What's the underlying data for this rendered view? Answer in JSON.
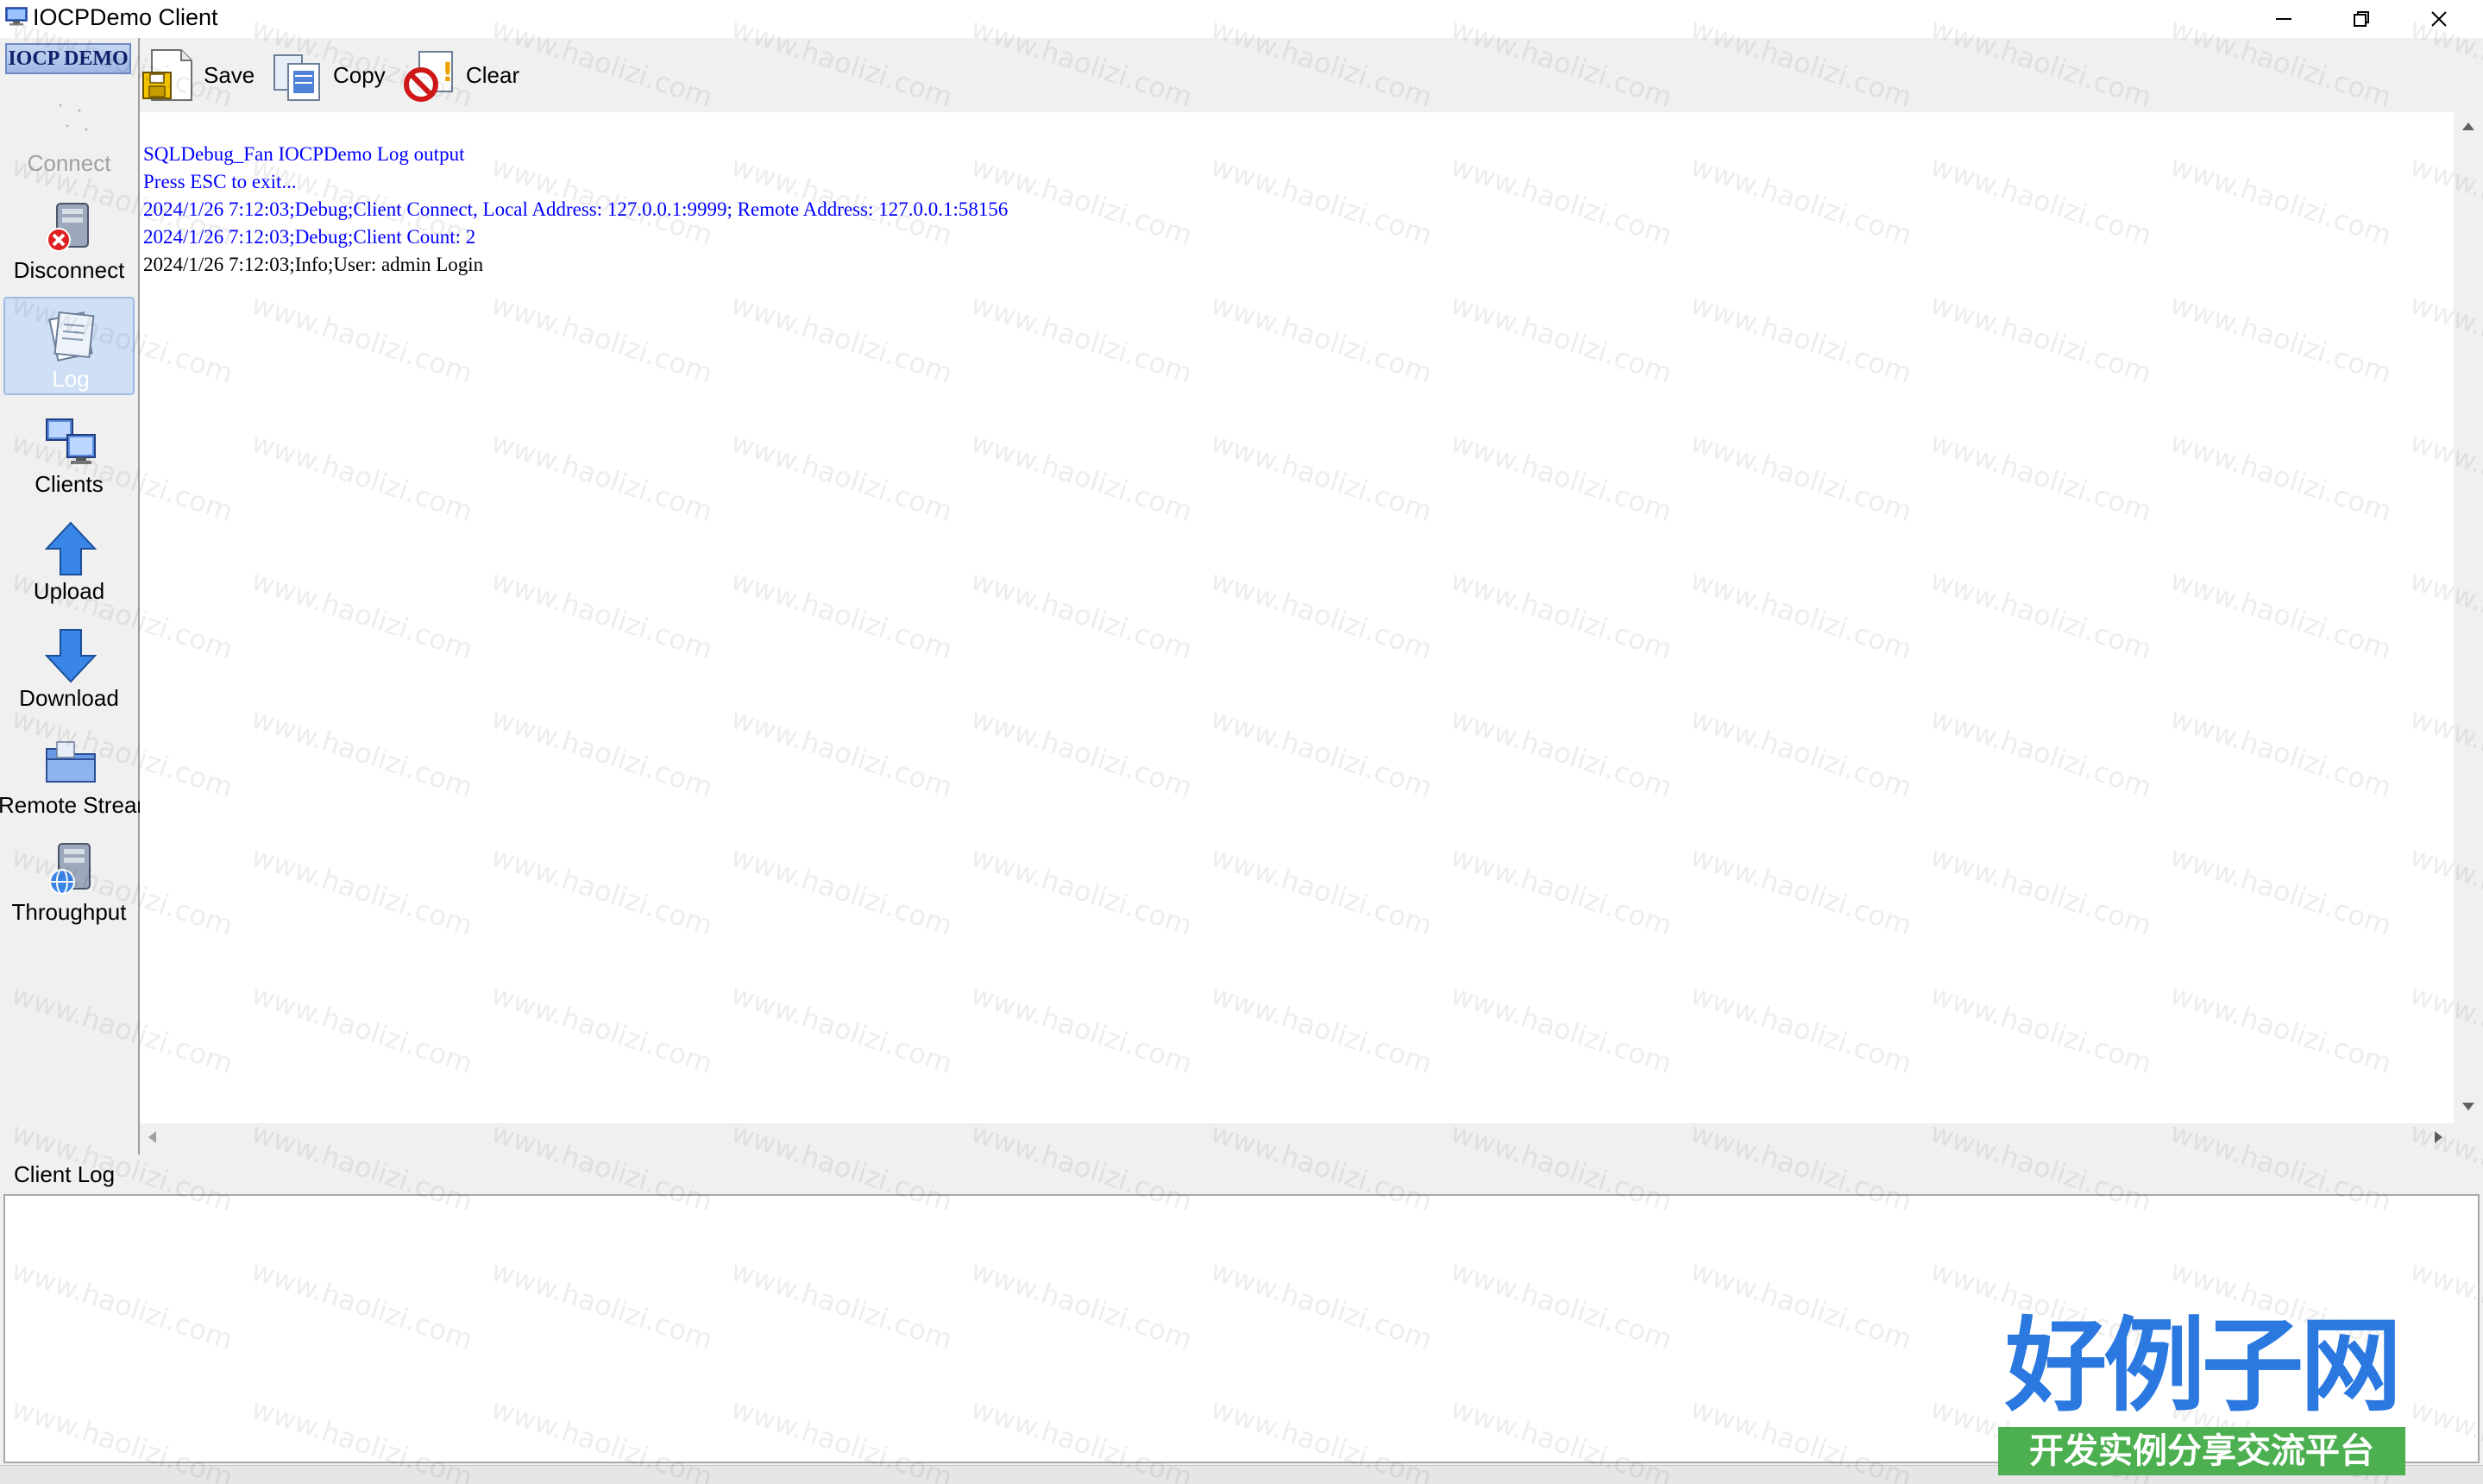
{
  "window": {
    "title": "IOCPDemo Client",
    "controls": {
      "minimize": "minimize-icon",
      "restore": "restore-icon",
      "close": "close-icon"
    }
  },
  "sidebar": {
    "brand": "IOCP DEMO",
    "items": [
      {
        "label": "Connect",
        "icon": "connect-icon",
        "state": "disabled"
      },
      {
        "label": "Disconnect",
        "icon": "disconnect-icon",
        "state": "normal"
      },
      {
        "label": "Log",
        "icon": "log-icon",
        "state": "active"
      },
      {
        "label": "Clients",
        "icon": "clients-icon",
        "state": "normal"
      },
      {
        "label": "Upload",
        "icon": "upload-arrow-icon",
        "state": "normal"
      },
      {
        "label": "Download",
        "icon": "download-arrow-icon",
        "state": "normal"
      },
      {
        "label": "Remote Stream",
        "icon": "remote-stream-icon",
        "state": "normal"
      },
      {
        "label": "Throughput",
        "icon": "throughput-icon",
        "state": "normal"
      }
    ]
  },
  "toolbar": {
    "save_label": "Save",
    "copy_label": "Copy",
    "clear_label": "Clear"
  },
  "log": {
    "lines": [
      {
        "text": "SQLDebug_Fan IOCPDemo Log output",
        "color": "#0000ff"
      },
      {
        "text": "Press ESC to exit...",
        "color": "#0000ff"
      },
      {
        "text": "2024/1/26 7:12:03;Debug;Client Connect, Local Address: 127.0.0.1:9999; Remote Address: 127.0.0.1:58156",
        "color": "#0000ff"
      },
      {
        "text": "2024/1/26 7:12:03;Debug;Client Count: 2",
        "color": "#0000ff"
      },
      {
        "text": "2024/1/26 7:12:03;Info;User: admin Login",
        "color": "#000000"
      }
    ]
  },
  "client_log": {
    "label": "Client Log"
  },
  "watermark": {
    "text": "www.haolizi.com",
    "brand_title": "好例子网",
    "brand_subtitle": "开发实例分享交流平台"
  }
}
